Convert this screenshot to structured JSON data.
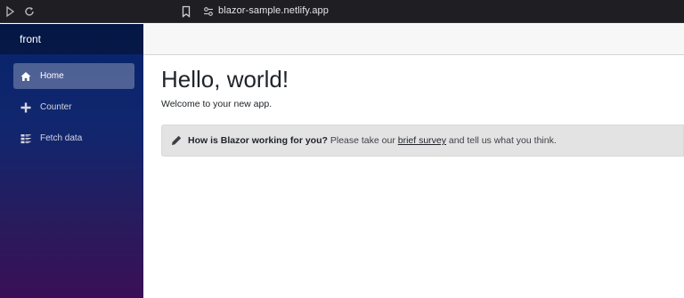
{
  "browser": {
    "url": "blazor-sample.netlify.app"
  },
  "sidebar": {
    "brand": "front",
    "items": [
      {
        "label": "Home",
        "icon": "home-icon",
        "active": true
      },
      {
        "label": "Counter",
        "icon": "plus-icon",
        "active": false
      },
      {
        "label": "Fetch data",
        "icon": "list-icon",
        "active": false
      }
    ]
  },
  "main": {
    "title": "Hello, world!",
    "welcome": "Welcome to your new app.",
    "alert": {
      "icon": "pencil-icon",
      "question": "How is Blazor working for you?",
      "text_before_link": " Please take our ",
      "link_text": "brief survey",
      "text_after_link": " and tell us what you think."
    }
  },
  "colors": {
    "sidebar_top": "#06246b",
    "sidebar_bottom": "#3a0f58",
    "alert_bg": "#e3e3e4"
  }
}
